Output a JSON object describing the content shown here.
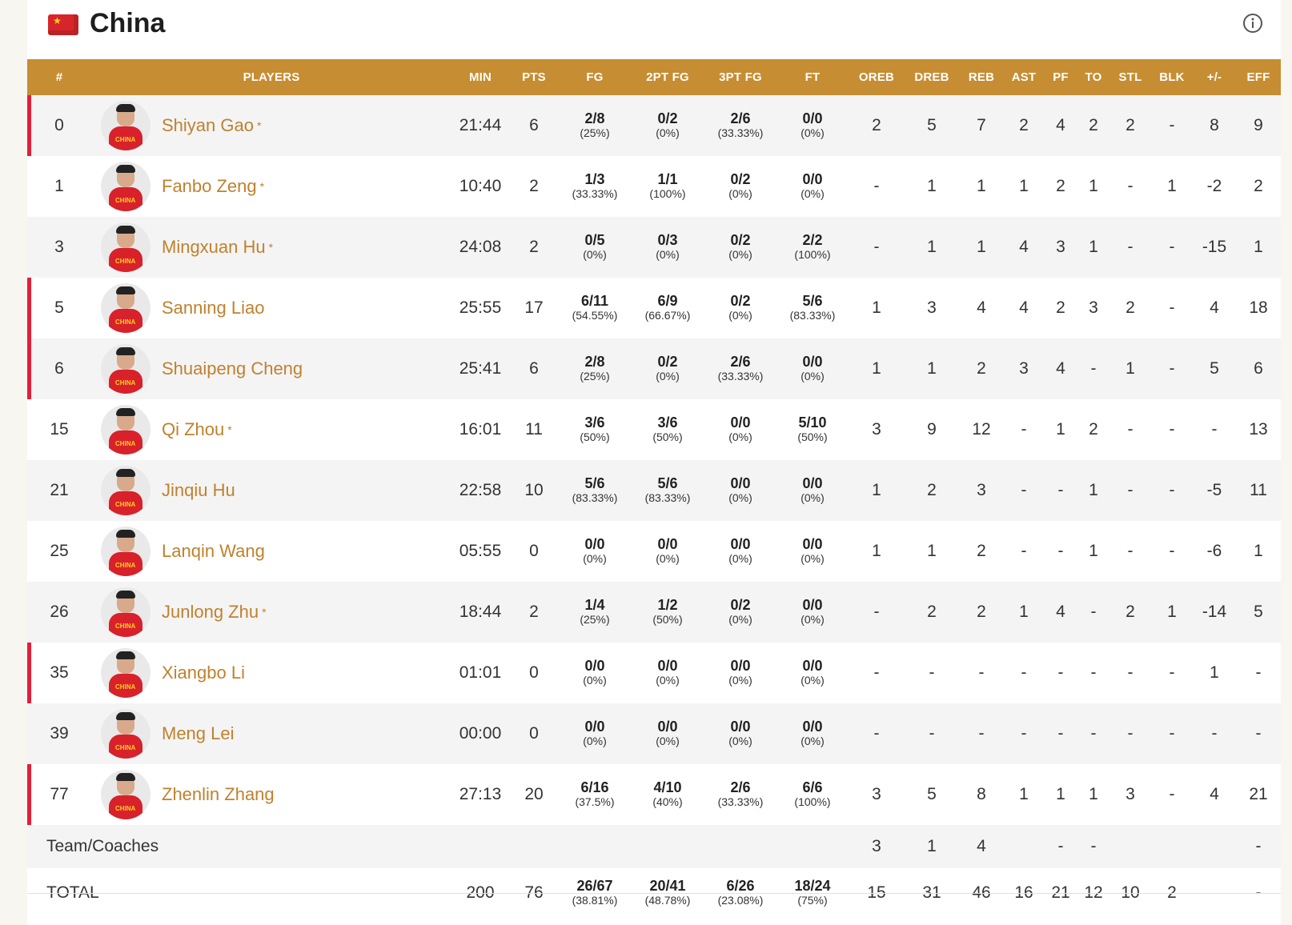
{
  "team": {
    "name": "China",
    "flag_colors": {
      "field": "#d7262b",
      "star": "#ffd21a"
    },
    "info_icon": "info-icon"
  },
  "colors": {
    "header_bg": "#c68d32",
    "starter_marker": "#e41e3a",
    "player_name": "#c0812e"
  },
  "columns": [
    "#",
    "PLAYERS",
    "MIN",
    "PTS",
    "FG",
    "2PT FG",
    "3PT FG",
    "FT",
    "OREB",
    "DREB",
    "REB",
    "AST",
    "PF",
    "TO",
    "STL",
    "BLK",
    "+/-",
    "EFF"
  ],
  "players": [
    {
      "num": "0",
      "name": "Shiyan Gao",
      "starred": true,
      "starter": true,
      "min": "21:44",
      "pts": "6",
      "fg": "2/8",
      "fg_pct": "(25%)",
      "fg2": "0/2",
      "fg2_pct": "(0%)",
      "fg3": "2/6",
      "fg3_pct": "(33.33%)",
      "ft": "0/0",
      "ft_pct": "(0%)",
      "oreb": "2",
      "dreb": "5",
      "reb": "7",
      "ast": "2",
      "pf": "4",
      "to": "2",
      "stl": "2",
      "blk": "-",
      "pm": "8",
      "eff": "9"
    },
    {
      "num": "1",
      "name": "Fanbo Zeng",
      "starred": true,
      "starter": false,
      "min": "10:40",
      "pts": "2",
      "fg": "1/3",
      "fg_pct": "(33.33%)",
      "fg2": "1/1",
      "fg2_pct": "(100%)",
      "fg3": "0/2",
      "fg3_pct": "(0%)",
      "ft": "0/0",
      "ft_pct": "(0%)",
      "oreb": "-",
      "dreb": "1",
      "reb": "1",
      "ast": "1",
      "pf": "2",
      "to": "1",
      "stl": "-",
      "blk": "1",
      "pm": "-2",
      "eff": "2"
    },
    {
      "num": "3",
      "name": "Mingxuan Hu",
      "starred": true,
      "starter": false,
      "min": "24:08",
      "pts": "2",
      "fg": "0/5",
      "fg_pct": "(0%)",
      "fg2": "0/3",
      "fg2_pct": "(0%)",
      "fg3": "0/2",
      "fg3_pct": "(0%)",
      "ft": "2/2",
      "ft_pct": "(100%)",
      "oreb": "-",
      "dreb": "1",
      "reb": "1",
      "ast": "4",
      "pf": "3",
      "to": "1",
      "stl": "-",
      "blk": "-",
      "pm": "-15",
      "eff": "1"
    },
    {
      "num": "5",
      "name": "Sanning Liao",
      "starred": false,
      "starter": true,
      "min": "25:55",
      "pts": "17",
      "fg": "6/11",
      "fg_pct": "(54.55%)",
      "fg2": "6/9",
      "fg2_pct": "(66.67%)",
      "fg3": "0/2",
      "fg3_pct": "(0%)",
      "ft": "5/6",
      "ft_pct": "(83.33%)",
      "oreb": "1",
      "dreb": "3",
      "reb": "4",
      "ast": "4",
      "pf": "2",
      "to": "3",
      "stl": "2",
      "blk": "-",
      "pm": "4",
      "eff": "18"
    },
    {
      "num": "6",
      "name": "Shuaipeng Cheng",
      "starred": false,
      "starter": true,
      "min": "25:41",
      "pts": "6",
      "fg": "2/8",
      "fg_pct": "(25%)",
      "fg2": "0/2",
      "fg2_pct": "(0%)",
      "fg3": "2/6",
      "fg3_pct": "(33.33%)",
      "ft": "0/0",
      "ft_pct": "(0%)",
      "oreb": "1",
      "dreb": "1",
      "reb": "2",
      "ast": "3",
      "pf": "4",
      "to": "-",
      "stl": "1",
      "blk": "-",
      "pm": "5",
      "eff": "6"
    },
    {
      "num": "15",
      "name": "Qi Zhou",
      "starred": true,
      "starter": false,
      "min": "16:01",
      "pts": "11",
      "fg": "3/6",
      "fg_pct": "(50%)",
      "fg2": "3/6",
      "fg2_pct": "(50%)",
      "fg3": "0/0",
      "fg3_pct": "(0%)",
      "ft": "5/10",
      "ft_pct": "(50%)",
      "oreb": "3",
      "dreb": "9",
      "reb": "12",
      "ast": "-",
      "pf": "1",
      "to": "2",
      "stl": "-",
      "blk": "-",
      "pm": "-",
      "eff": "13"
    },
    {
      "num": "21",
      "name": "Jinqiu Hu",
      "starred": false,
      "starter": false,
      "min": "22:58",
      "pts": "10",
      "fg": "5/6",
      "fg_pct": "(83.33%)",
      "fg2": "5/6",
      "fg2_pct": "(83.33%)",
      "fg3": "0/0",
      "fg3_pct": "(0%)",
      "ft": "0/0",
      "ft_pct": "(0%)",
      "oreb": "1",
      "dreb": "2",
      "reb": "3",
      "ast": "-",
      "pf": "-",
      "to": "1",
      "stl": "-",
      "blk": "-",
      "pm": "-5",
      "eff": "11"
    },
    {
      "num": "25",
      "name": "Lanqin Wang",
      "starred": false,
      "starter": false,
      "min": "05:55",
      "pts": "0",
      "fg": "0/0",
      "fg_pct": "(0%)",
      "fg2": "0/0",
      "fg2_pct": "(0%)",
      "fg3": "0/0",
      "fg3_pct": "(0%)",
      "ft": "0/0",
      "ft_pct": "(0%)",
      "oreb": "1",
      "dreb": "1",
      "reb": "2",
      "ast": "-",
      "pf": "-",
      "to": "1",
      "stl": "-",
      "blk": "-",
      "pm": "-6",
      "eff": "1"
    },
    {
      "num": "26",
      "name": "Junlong Zhu",
      "starred": true,
      "starter": false,
      "min": "18:44",
      "pts": "2",
      "fg": "1/4",
      "fg_pct": "(25%)",
      "fg2": "1/2",
      "fg2_pct": "(50%)",
      "fg3": "0/2",
      "fg3_pct": "(0%)",
      "ft": "0/0",
      "ft_pct": "(0%)",
      "oreb": "-",
      "dreb": "2",
      "reb": "2",
      "ast": "1",
      "pf": "4",
      "to": "-",
      "stl": "2",
      "blk": "1",
      "pm": "-14",
      "eff": "5"
    },
    {
      "num": "35",
      "name": "Xiangbo Li",
      "starred": false,
      "starter": true,
      "min": "01:01",
      "pts": "0",
      "fg": "0/0",
      "fg_pct": "(0%)",
      "fg2": "0/0",
      "fg2_pct": "(0%)",
      "fg3": "0/0",
      "fg3_pct": "(0%)",
      "ft": "0/0",
      "ft_pct": "(0%)",
      "oreb": "-",
      "dreb": "-",
      "reb": "-",
      "ast": "-",
      "pf": "-",
      "to": "-",
      "stl": "-",
      "blk": "-",
      "pm": "1",
      "eff": "-"
    },
    {
      "num": "39",
      "name": "Meng Lei",
      "starred": false,
      "starter": false,
      "min": "00:00",
      "pts": "0",
      "fg": "0/0",
      "fg_pct": "(0%)",
      "fg2": "0/0",
      "fg2_pct": "(0%)",
      "fg3": "0/0",
      "fg3_pct": "(0%)",
      "ft": "0/0",
      "ft_pct": "(0%)",
      "oreb": "-",
      "dreb": "-",
      "reb": "-",
      "ast": "-",
      "pf": "-",
      "to": "-",
      "stl": "-",
      "blk": "-",
      "pm": "-",
      "eff": "-"
    },
    {
      "num": "77",
      "name": "Zhenlin Zhang",
      "starred": false,
      "starter": true,
      "min": "27:13",
      "pts": "20",
      "fg": "6/16",
      "fg_pct": "(37.5%)",
      "fg2": "4/10",
      "fg2_pct": "(40%)",
      "fg3": "2/6",
      "fg3_pct": "(33.33%)",
      "ft": "6/6",
      "ft_pct": "(100%)",
      "oreb": "3",
      "dreb": "5",
      "reb": "8",
      "ast": "1",
      "pf": "1",
      "to": "1",
      "stl": "3",
      "blk": "-",
      "pm": "4",
      "eff": "21"
    }
  ],
  "team_row": {
    "label": "Team/Coaches",
    "oreb": "3",
    "dreb": "1",
    "reb": "4",
    "pf": "-",
    "to": "-",
    "eff": "-"
  },
  "total_row": {
    "label": "TOTAL",
    "min": "200",
    "pts": "76",
    "fg": "26/67",
    "fg_pct": "(38.81%)",
    "fg2": "20/41",
    "fg2_pct": "(48.78%)",
    "fg3": "6/26",
    "fg3_pct": "(23.08%)",
    "ft": "18/24",
    "ft_pct": "(75%)",
    "oreb": "15",
    "dreb": "31",
    "reb": "46",
    "ast": "16",
    "pf": "21",
    "to": "12",
    "stl": "10",
    "blk": "2",
    "eff": "-"
  }
}
